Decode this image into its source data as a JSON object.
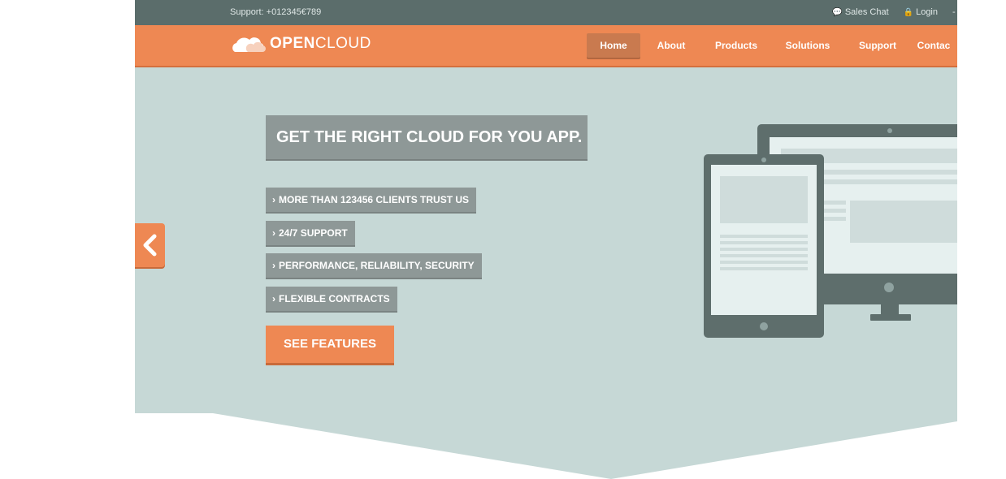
{
  "topbar": {
    "support": "Support: +012345€789",
    "sales_chat": "Sales Chat",
    "login": "Login"
  },
  "brand": {
    "open": "OPEN",
    "cloud": "CLOUD"
  },
  "nav": {
    "items": [
      {
        "label": "Home",
        "active": true
      },
      {
        "label": "About",
        "active": false
      },
      {
        "label": "Products",
        "active": false
      },
      {
        "label": "Solutions",
        "active": false
      },
      {
        "label": "Support",
        "active": false
      },
      {
        "label": "Contac",
        "active": false
      }
    ]
  },
  "hero": {
    "headline": "GET THE RIGHT CLOUD FOR YOU APP.",
    "features": [
      "MORE THAN 123456 CLIENTS TRUST US",
      "24/7 SUPPORT",
      "PERFORMANCE, RELIABILITY, SECURITY",
      "FLEXIBLE CONTRACTS"
    ],
    "cta": "SEE FEATURES",
    "prev_icon": "chevron-left-icon"
  },
  "colors": {
    "accent": "#ee8853",
    "topbar": "#5b6d6b",
    "hero_bg": "#c6d8d6",
    "label_bg": "#8e9897",
    "device": "#5e6e6c"
  }
}
